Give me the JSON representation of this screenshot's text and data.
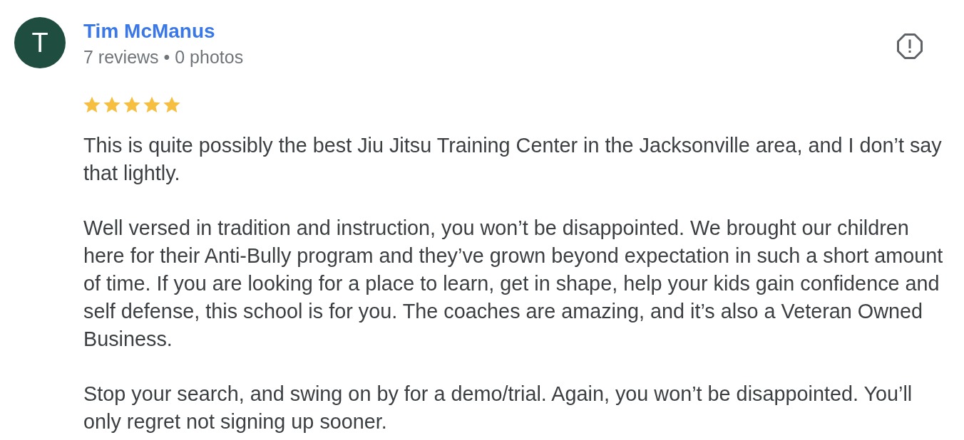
{
  "review": {
    "avatar_initial": "T",
    "author": "Tim McManus",
    "meta": "7 reviews • 0 photos",
    "stars": 5,
    "paragraphs": [
      "This is quite possibly the best Jiu Jitsu Training Center in the Jacksonville area, and I don’t say that lightly.",
      "Well versed in tradition and instruction, you won’t be disappointed. We brought our children here for their Anti-Bully program and they’ve grown beyond expectation in such a short amount of time. If you are looking for a place to learn, get in shape, help your kids gain confidence and self defense, this school is for you. The coaches are amazing, and it’s also a Veteran Owned Business.",
      "Stop your search, and swing on by for a demo/trial. Again, you won’t be disappointed. You’ll only regret not signing up sooner."
    ]
  }
}
